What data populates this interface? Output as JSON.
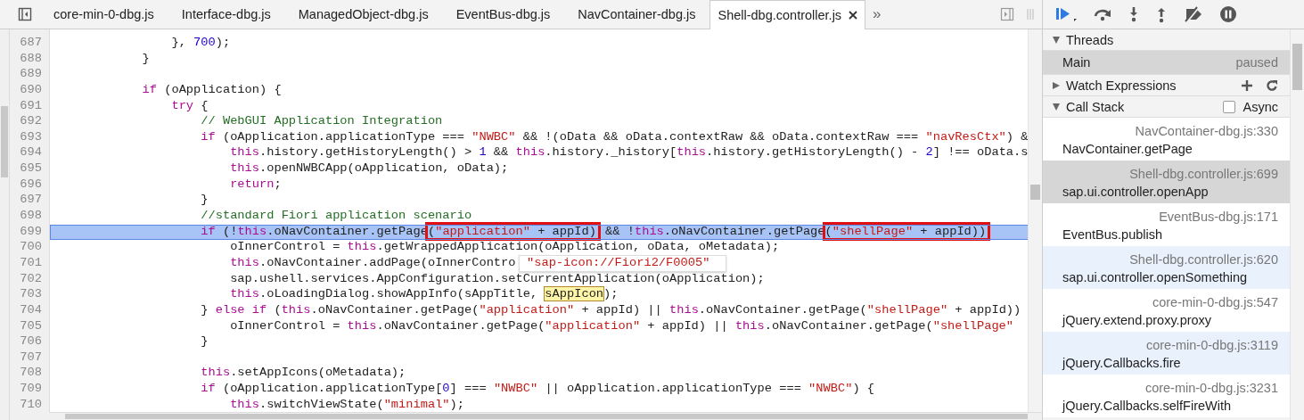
{
  "tabs": [
    {
      "label": "core-min-0-dbg.js",
      "selected": false
    },
    {
      "label": "Interface-dbg.js",
      "selected": false
    },
    {
      "label": "ManagedObject-dbg.js",
      "selected": false
    },
    {
      "label": "EventBus-dbg.js",
      "selected": false
    },
    {
      "label": "NavContainer-dbg.js",
      "selected": false
    },
    {
      "label": "Shell-dbg.controller.js",
      "selected": true
    }
  ],
  "more_tabs": "»",
  "code": [
    {
      "number": "687",
      "selected": false,
      "tokens": [
        {
          "kind": "plain",
          "text": "                }, "
        },
        {
          "kind": "number",
          "text": "700"
        },
        {
          "kind": "plain",
          "text": ");"
        }
      ]
    },
    {
      "number": "688",
      "selected": false,
      "tokens": [
        {
          "kind": "plain",
          "text": "            }"
        }
      ]
    },
    {
      "number": "689",
      "selected": false
    },
    {
      "number": "690",
      "selected": false,
      "tokens": [
        {
          "kind": "keyword",
          "text": "            if"
        },
        {
          "kind": "plain",
          "text": " (oApplication) {"
        }
      ]
    },
    {
      "number": "691",
      "selected": false,
      "tokens": [
        {
          "kind": "keyword",
          "text": "                try"
        },
        {
          "kind": "plain",
          "text": " {"
        }
      ]
    },
    {
      "number": "692",
      "selected": false,
      "tokens": [
        {
          "kind": "comment",
          "text": "                    // WebGUI Application Integration"
        }
      ]
    },
    {
      "number": "693",
      "selected": false,
      "tokens": [
        {
          "kind": "keyword",
          "text": "                    if"
        },
        {
          "kind": "plain",
          "text": " (oApplication.applicationType === "
        },
        {
          "kind": "string",
          "text": "\"NWBC\""
        },
        {
          "kind": "plain",
          "text": " && !(oData && oData.contextRaw && oData.contextRaw === "
        },
        {
          "kind": "string",
          "text": "\"navResCtx\""
        },
        {
          "kind": "plain",
          "text": ") &"
        }
      ]
    },
    {
      "number": "694",
      "selected": false,
      "tokens": [
        {
          "kind": "keyword",
          "text": "                        this"
        },
        {
          "kind": "plain",
          "text": ".history.getHistoryLength() > "
        },
        {
          "kind": "number",
          "text": "1"
        },
        {
          "kind": "plain",
          "text": " && "
        },
        {
          "kind": "keyword",
          "text": "this"
        },
        {
          "kind": "plain",
          "text": ".history._history["
        },
        {
          "kind": "keyword",
          "text": "this"
        },
        {
          "kind": "plain",
          "text": ".history.getHistoryLength() - "
        },
        {
          "kind": "number",
          "text": "2"
        },
        {
          "kind": "plain",
          "text": "] !== oData.s"
        }
      ]
    },
    {
      "number": "695",
      "selected": false,
      "tokens": [
        {
          "kind": "keyword",
          "text": "                        this"
        },
        {
          "kind": "plain",
          "text": ".openNWBCApp(oApplication, oData);"
        }
      ]
    },
    {
      "number": "696",
      "selected": false,
      "tokens": [
        {
          "kind": "keyword",
          "text": "                        return"
        },
        {
          "kind": "plain",
          "text": ";"
        }
      ]
    },
    {
      "number": "697",
      "selected": false,
      "tokens": [
        {
          "kind": "plain",
          "text": "                    }"
        }
      ]
    },
    {
      "number": "698",
      "selected": false,
      "tokens": [
        {
          "kind": "comment",
          "text": "                    //standard Fiori application scenario"
        }
      ]
    },
    {
      "number": "699",
      "selected": true,
      "tokens": [
        {
          "kind": "keyword",
          "text": "                    if"
        },
        {
          "kind": "plain",
          "text": " (!"
        },
        {
          "kind": "keyword",
          "text": "this"
        },
        {
          "kind": "plain",
          "text": ".oNavContainer.getPage"
        },
        {
          "kind": "boxed",
          "tokens": [
            {
              "kind": "plain",
              "text": "("
            },
            {
              "kind": "string",
              "text": "\"application\""
            },
            {
              "kind": "plain",
              "text": " + appId)"
            }
          ]
        },
        {
          "kind": "plain",
          "text": " && !"
        },
        {
          "kind": "keyword",
          "text": "this"
        },
        {
          "kind": "plain",
          "text": ".oNavContainer.getPage"
        },
        {
          "kind": "boxed",
          "tokens": [
            {
              "kind": "plain",
              "text": "("
            },
            {
              "kind": "string",
              "text": "\"shellPage\""
            },
            {
              "kind": "plain",
              "text": " + appId))"
            }
          ]
        }
      ]
    },
    {
      "number": "700",
      "selected": false,
      "tokens": [
        {
          "kind": "plain",
          "text": "                        oInnerControl = "
        },
        {
          "kind": "keyword",
          "text": "this"
        },
        {
          "kind": "plain",
          "text": ".getWrappedApplication(oApplication, oData, oMetadata);"
        }
      ]
    },
    {
      "number": "701",
      "selected": false,
      "tokens": [
        {
          "kind": "keyword",
          "text": "                        this"
        },
        {
          "kind": "plain",
          "text": ".oNavContainer.addPage(oInnerContro"
        }
      ]
    },
    {
      "number": "702",
      "selected": false,
      "tokens": [
        {
          "kind": "plain",
          "text": "                        sap.ushell.services.AppConfiguration.setCurrentApplication(oApplication);"
        }
      ]
    },
    {
      "number": "703",
      "selected": false,
      "tokens": [
        {
          "kind": "keyword",
          "text": "                        this"
        },
        {
          "kind": "plain",
          "text": ".oLoadingDialog.showAppInfo(sAppTitle, "
        },
        {
          "kind": "hover",
          "text": "sAppIcon"
        },
        {
          "kind": "plain",
          "text": ");"
        }
      ]
    },
    {
      "number": "704",
      "selected": false,
      "tokens": [
        {
          "kind": "plain",
          "text": "                    } "
        },
        {
          "kind": "keyword",
          "text": "else if"
        },
        {
          "kind": "plain",
          "text": " ("
        },
        {
          "kind": "keyword",
          "text": "this"
        },
        {
          "kind": "plain",
          "text": ".oNavContainer.getPage("
        },
        {
          "kind": "string",
          "text": "\"application\""
        },
        {
          "kind": "plain",
          "text": " + appId) || "
        },
        {
          "kind": "keyword",
          "text": "this"
        },
        {
          "kind": "plain",
          "text": ".oNavContainer.getPage("
        },
        {
          "kind": "string",
          "text": "\"shellPage\""
        },
        {
          "kind": "plain",
          "text": " + appId))"
        }
      ]
    },
    {
      "number": "705",
      "selected": false,
      "tokens": [
        {
          "kind": "plain",
          "text": "                        oInnerControl = "
        },
        {
          "kind": "keyword",
          "text": "this"
        },
        {
          "kind": "plain",
          "text": ".oNavContainer.getPage("
        },
        {
          "kind": "string",
          "text": "\"application\""
        },
        {
          "kind": "plain",
          "text": " + appId) || "
        },
        {
          "kind": "keyword",
          "text": "this"
        },
        {
          "kind": "plain",
          "text": ".oNavContainer.getPage("
        },
        {
          "kind": "string",
          "text": "\"shellPage\""
        }
      ]
    },
    {
      "number": "706",
      "selected": false,
      "tokens": [
        {
          "kind": "plain",
          "text": "                    }"
        }
      ]
    },
    {
      "number": "707",
      "selected": false
    },
    {
      "number": "708",
      "selected": false,
      "tokens": [
        {
          "kind": "keyword",
          "text": "                    this"
        },
        {
          "kind": "plain",
          "text": ".setAppIcons(oMetadata);"
        }
      ]
    },
    {
      "number": "709",
      "selected": false,
      "tokens": [
        {
          "kind": "keyword",
          "text": "                    if"
        },
        {
          "kind": "plain",
          "text": " (oApplication.applicationType["
        },
        {
          "kind": "number",
          "text": "0"
        },
        {
          "kind": "plain",
          "text": "] === "
        },
        {
          "kind": "string",
          "text": "\"NWBC\""
        },
        {
          "kind": "plain",
          "text": " || oApplication.applicationType === "
        },
        {
          "kind": "string",
          "text": "\"NWBC\""
        },
        {
          "kind": "plain",
          "text": ") {"
        }
      ]
    },
    {
      "number": "710",
      "selected": false,
      "tokens": [
        {
          "kind": "keyword",
          "text": "                        this"
        },
        {
          "kind": "plain",
          "text": ".switchViewState("
        },
        {
          "kind": "string",
          "text": "\"minimal\""
        },
        {
          "kind": "plain",
          "text": ");"
        }
      ]
    }
  ],
  "tooltip": {
    "text": "\"sap-icon://Fiori2/F0005\""
  },
  "threads": {
    "title": "Threads",
    "expanded": true,
    "items": [
      {
        "name": "Main",
        "status": "paused",
        "selected": true
      }
    ]
  },
  "watch": {
    "title": "Watch Expressions",
    "expanded": false
  },
  "call_stack": {
    "title": "Call Stack",
    "expanded": true,
    "async_label": "Async",
    "async_checked": false,
    "frames": [
      {
        "location": "NavContainer-dbg.js:330",
        "function": "NavContainer.getPage",
        "selected": false,
        "highlighted": false
      },
      {
        "location": "Shell-dbg.controller.js:699",
        "function": "sap.ui.controller.openApp",
        "selected": true,
        "highlighted": false
      },
      {
        "location": "EventBus-dbg.js:171",
        "function": "EventBus.publish",
        "selected": false,
        "highlighted": false
      },
      {
        "location": "Shell-dbg.controller.js:620",
        "function": "sap.ui.controller.openSomething",
        "selected": false,
        "highlighted": true
      },
      {
        "location": "core-min-0-dbg.js:547",
        "function": "jQuery.extend.proxy.proxy",
        "selected": false,
        "highlighted": false
      },
      {
        "location": "core-min-0-dbg.js:3119",
        "function": "jQuery.Callbacks.fire",
        "selected": false,
        "highlighted": true
      },
      {
        "location": "core-min-0-dbg.js:3231",
        "function": "jQuery.Callbacks.selfFireWith",
        "selected": false,
        "highlighted": false
      }
    ]
  }
}
